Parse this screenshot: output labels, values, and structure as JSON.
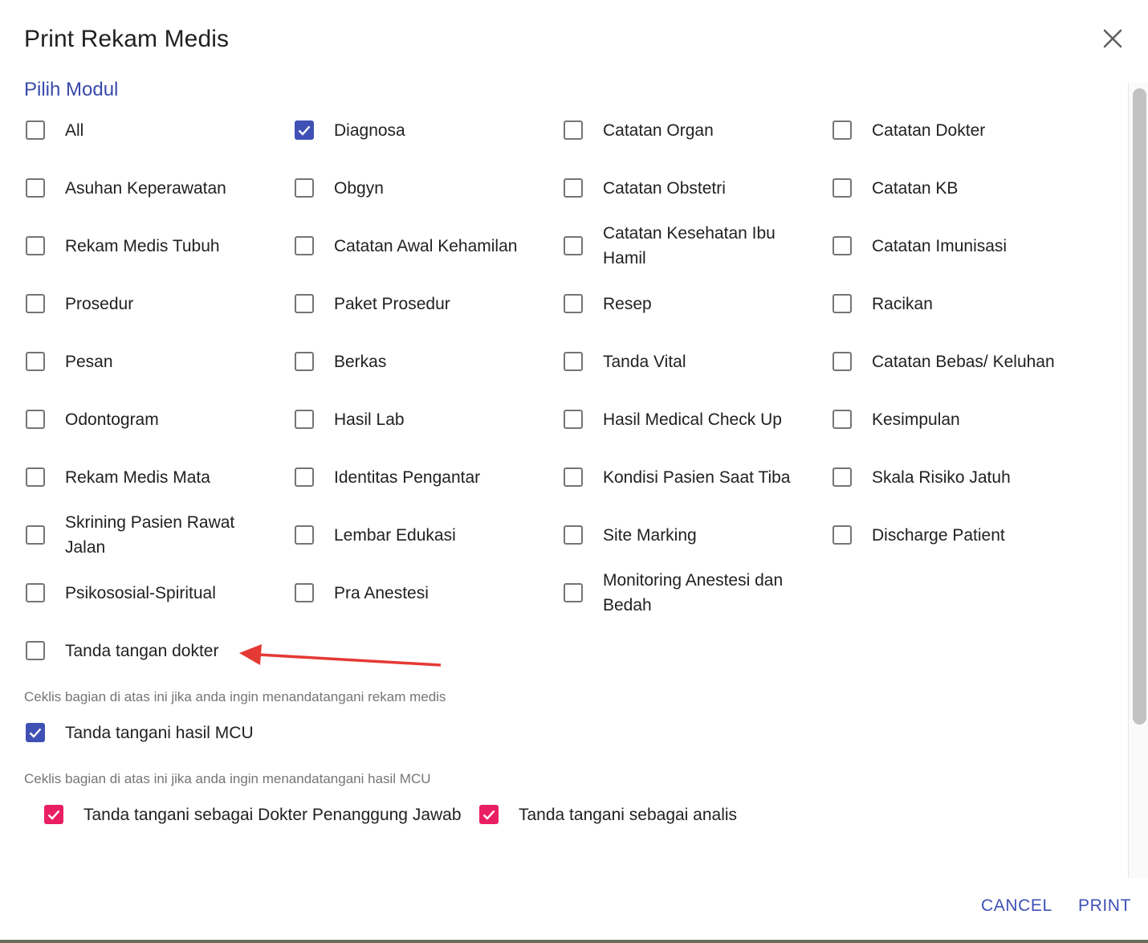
{
  "dialog": {
    "title": "Print Rekam Medis",
    "close_icon": "close-icon",
    "section_title": "Pilih Modul"
  },
  "modules": [
    {
      "label": "All",
      "checked": false
    },
    {
      "label": "Diagnosa",
      "checked": true
    },
    {
      "label": "Catatan Organ",
      "checked": false
    },
    {
      "label": "Catatan Dokter",
      "checked": false
    },
    {
      "label": "Asuhan Keperawatan",
      "checked": false
    },
    {
      "label": "Obgyn",
      "checked": false
    },
    {
      "label": "Catatan Obstetri",
      "checked": false
    },
    {
      "label": "Catatan KB",
      "checked": false
    },
    {
      "label": "Rekam Medis Tubuh",
      "checked": false
    },
    {
      "label": "Catatan Awal Kehamilan",
      "checked": false
    },
    {
      "label": "Catatan Kesehatan Ibu Hamil",
      "checked": false
    },
    {
      "label": "Catatan Imunisasi",
      "checked": false
    },
    {
      "label": "Prosedur",
      "checked": false
    },
    {
      "label": "Paket Prosedur",
      "checked": false
    },
    {
      "label": "Resep",
      "checked": false
    },
    {
      "label": "Racikan",
      "checked": false
    },
    {
      "label": "Pesan",
      "checked": false
    },
    {
      "label": "Berkas",
      "checked": false
    },
    {
      "label": "Tanda Vital",
      "checked": false
    },
    {
      "label": "Catatan Bebas/ Keluhan",
      "checked": false
    },
    {
      "label": "Odontogram",
      "checked": false
    },
    {
      "label": "Hasil Lab",
      "checked": false
    },
    {
      "label": "Hasil Medical Check Up",
      "checked": false
    },
    {
      "label": "Kesimpulan",
      "checked": false
    },
    {
      "label": "Rekam Medis Mata",
      "checked": false
    },
    {
      "label": "Identitas Pengantar",
      "checked": false
    },
    {
      "label": "Kondisi Pasien Saat Tiba",
      "checked": false
    },
    {
      "label": "Skala Risiko Jatuh",
      "checked": false
    },
    {
      "label": "Skrining Pasien Rawat Jalan",
      "checked": false
    },
    {
      "label": "Lembar Edukasi",
      "checked": false
    },
    {
      "label": "Site Marking",
      "checked": false
    },
    {
      "label": "Discharge Patient",
      "checked": false
    },
    {
      "label": "Psikososial-Spiritual",
      "checked": false
    },
    {
      "label": "Pra Anestesi",
      "checked": false
    },
    {
      "label": "Monitoring Anestesi dan Bedah",
      "checked": false
    }
  ],
  "signature": {
    "doctor_label": "Tanda tangan dokter",
    "doctor_checked": false,
    "doctor_helper": "Ceklis bagian di atas ini jika anda ingin menandatangani rekam medis",
    "mcu_label": "Tanda tangani hasil MCU",
    "mcu_checked": true,
    "mcu_helper": "Ceklis bagian di atas ini jika anda ingin menandatangani hasil MCU",
    "dpjp_label": "Tanda tangani sebagai Dokter Penanggung Jawab",
    "dpjp_checked": true,
    "analyst_label": "Tanda tangani sebagai analis",
    "analyst_checked": true
  },
  "actions": {
    "cancel_label": "CANCEL",
    "print_label": "PRINT"
  },
  "colors": {
    "primary": "#3f51b5",
    "accent_pink": "#e91e63",
    "annotation_arrow": "#e53935",
    "helper_text": "#757575"
  }
}
